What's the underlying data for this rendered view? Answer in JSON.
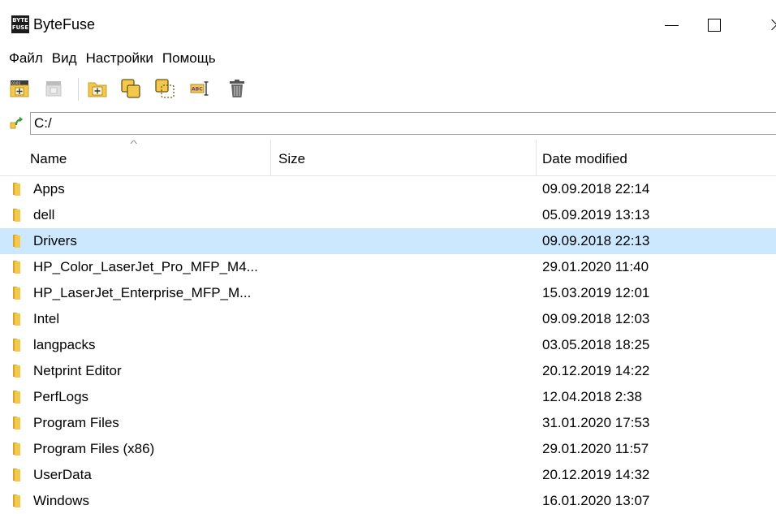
{
  "app": {
    "title": "ByteFuse",
    "logo_top": "BYTE",
    "logo_bottom": "FUSE"
  },
  "menu": {
    "items": [
      "Файл",
      "Вид",
      "Настройки",
      "Помощь"
    ]
  },
  "toolbar": {
    "icons": [
      "new-archive-icon",
      "disabled-archive-icon",
      "new-folder-icon",
      "copy-icon",
      "move-icon",
      "rename-icon",
      "delete-icon"
    ]
  },
  "path": {
    "value": "C:/"
  },
  "table": {
    "columns": [
      "Name",
      "Size",
      "Date modified"
    ],
    "sorted_by": "Name",
    "sort_direction": "ascending",
    "rows": [
      {
        "name": "Apps",
        "size": "",
        "date": "09.09.2018 22:14"
      },
      {
        "name": "dell",
        "size": "",
        "date": "05.09.2019 13:13"
      },
      {
        "name": "Drivers",
        "size": "",
        "date": "09.09.2018 22:13",
        "selected": true
      },
      {
        "name": "HP_Color_LaserJet_Pro_MFP_M4...",
        "size": "",
        "date": "29.01.2020 11:40"
      },
      {
        "name": "HP_LaserJet_Enterprise_MFP_M...",
        "size": "",
        "date": "15.03.2019 12:01"
      },
      {
        "name": "Intel",
        "size": "",
        "date": "09.09.2018 12:03"
      },
      {
        "name": "langpacks",
        "size": "",
        "date": "03.05.2018 18:25"
      },
      {
        "name": "Netprint Editor",
        "size": "",
        "date": "20.12.2019 14:22"
      },
      {
        "name": "PerfLogs",
        "size": "",
        "date": "12.04.2018 2:38"
      },
      {
        "name": "Program Files",
        "size": "",
        "date": "31.01.2020 17:53"
      },
      {
        "name": "Program Files (x86)",
        "size": "",
        "date": "29.01.2020 11:57"
      },
      {
        "name": "UserData",
        "size": "",
        "date": "20.12.2019 14:32"
      },
      {
        "name": "Windows",
        "size": "",
        "date": "16.01.2020 13:07"
      }
    ]
  },
  "colors": {
    "selection": "#cce8ff",
    "folder": "#f2c94c",
    "folder_dark": "#d9a42a"
  }
}
